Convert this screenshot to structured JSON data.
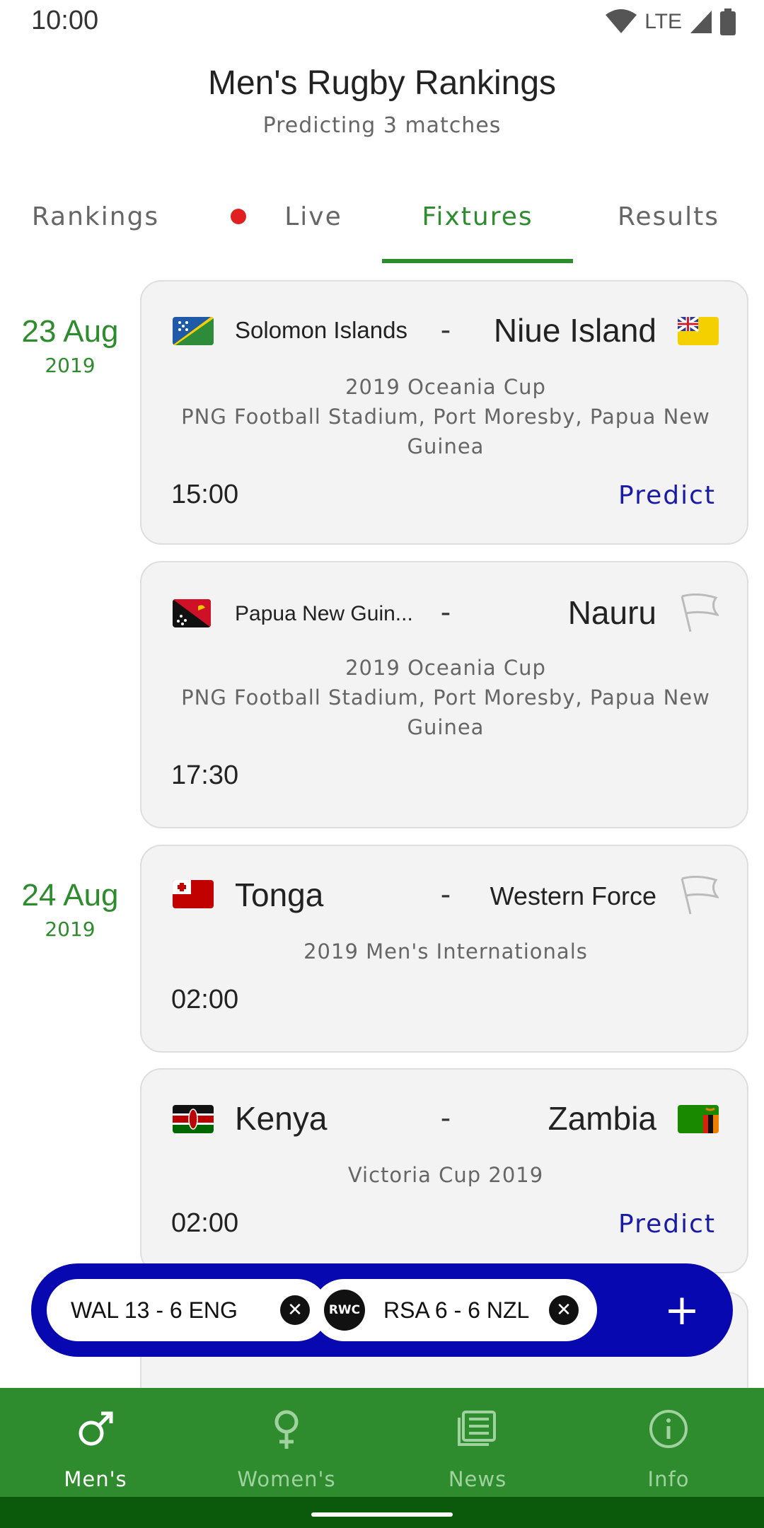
{
  "status_bar": {
    "time": "10:00",
    "network": "LTE"
  },
  "header": {
    "title": "Men's Rugby Rankings",
    "subtitle": "Predicting 3 matches"
  },
  "tabs": [
    {
      "label": "Rankings"
    },
    {
      "label": "Live"
    },
    {
      "label": "Fixtures",
      "active": true
    },
    {
      "label": "Results"
    }
  ],
  "dates": [
    {
      "day": "23 Aug",
      "year": "2019"
    },
    {
      "day": "24 Aug",
      "year": "2019"
    }
  ],
  "fixtures": [
    {
      "home": "Solomon Islands",
      "separator": "-",
      "away": "Niue Island",
      "competition": "2019 Oceania Cup",
      "venue": "PNG Football Stadium, Port Moresby, Papua New Guinea",
      "time": "15:00",
      "predict_label": "Predict"
    },
    {
      "home": "Papua New Guin...",
      "separator": "-",
      "away": "Nauru",
      "competition": "2019 Oceania Cup",
      "venue": "PNG Football Stadium, Port Moresby, Papua New Guinea",
      "time": "17:30"
    },
    {
      "home": "Tonga",
      "separator": "-",
      "away": "Western Force",
      "competition": "2019 Men's Internationals",
      "time": "02:00"
    },
    {
      "home": "Kenya",
      "separator": "-",
      "away": "Zambia",
      "competition": "Victoria Cup 2019",
      "time": "02:00",
      "predict_label": "Predict"
    }
  ],
  "live_bar": {
    "chips": [
      {
        "text": "WAL 13 - 6 ENG"
      },
      {
        "logo": "RWC",
        "text": "RSA 6 - 6 NZL"
      }
    ],
    "add_label": "+"
  },
  "bottom_nav": [
    {
      "label": "Men's",
      "icon": "male-icon",
      "active": true
    },
    {
      "label": "Women's",
      "icon": "female-icon"
    },
    {
      "label": "News",
      "icon": "news-icon"
    },
    {
      "label": "Info",
      "icon": "info-icon"
    }
  ],
  "colors": {
    "accent": "#2e8b2e",
    "predict": "#1a1aa8",
    "live_bar": "#0808b0",
    "live_dot": "#e02020"
  }
}
